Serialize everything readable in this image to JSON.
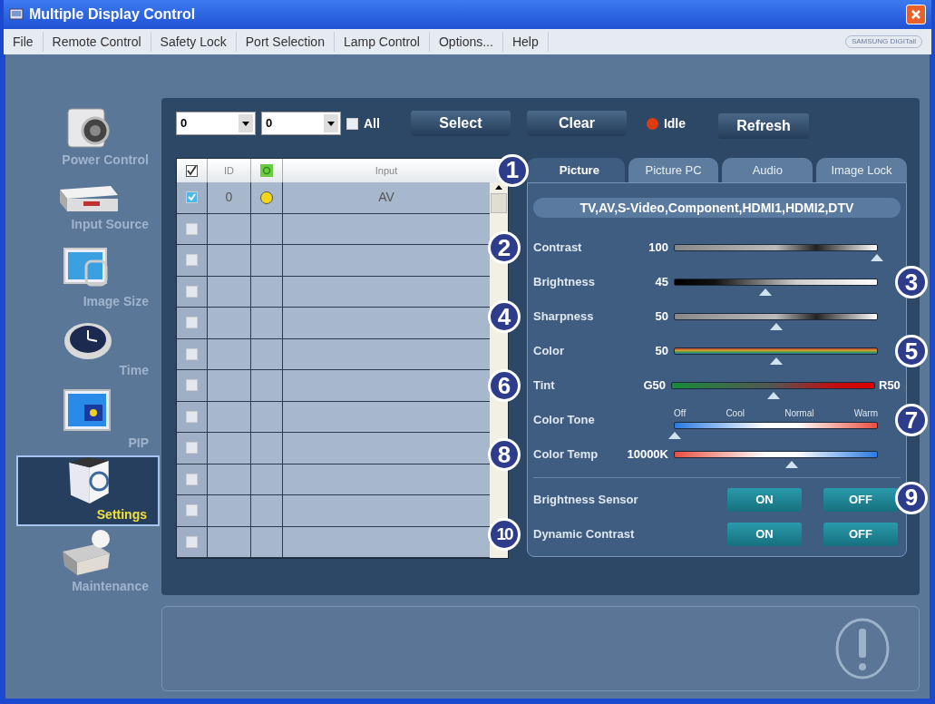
{
  "window": {
    "title": "Multiple Display Control"
  },
  "menu": [
    "File",
    "Remote Control",
    "Safety Lock",
    "Port Selection",
    "Lamp Control",
    "Options...",
    "Help"
  ],
  "logo": "SAMSUNG DIGITall",
  "sidebar": [
    {
      "label": "Power Control",
      "selected": false
    },
    {
      "label": "Input Source",
      "selected": false
    },
    {
      "label": "Image Size",
      "selected": false
    },
    {
      "label": "Time",
      "selected": false
    },
    {
      "label": "PIP",
      "selected": false
    },
    {
      "label": "Settings",
      "selected": true
    },
    {
      "label": "Maintenance",
      "selected": false
    }
  ],
  "toolbar": {
    "dropdowns": [
      "0",
      "0"
    ],
    "all": {
      "label": "All",
      "checked": false
    },
    "select": "Select",
    "clear": "Clear",
    "status": {
      "label": "Idle",
      "color": "#e03a10"
    },
    "refresh": "Refresh"
  },
  "table": {
    "header_checked": true,
    "columns": [
      "ID",
      "Input"
    ],
    "rows": [
      {
        "checked": true,
        "id": "0",
        "color": "#f0d818",
        "input": "AV"
      },
      {
        "checked": false
      },
      {
        "checked": false
      },
      {
        "checked": false
      },
      {
        "checked": false
      },
      {
        "checked": false
      },
      {
        "checked": false
      },
      {
        "checked": false
      },
      {
        "checked": false
      },
      {
        "checked": false
      },
      {
        "checked": false
      },
      {
        "checked": false
      }
    ]
  },
  "tabs": [
    {
      "label": "Picture",
      "selected": true
    },
    {
      "label": "Picture PC",
      "selected": false
    },
    {
      "label": "Audio",
      "selected": false
    },
    {
      "label": "Image Lock",
      "selected": false
    }
  ],
  "tab_callout": "1",
  "sources": "TV,AV,S-Video,Component,HDMI1,HDMI2,DTV",
  "settings": [
    {
      "kind": "slider",
      "label": "Contrast",
      "value": "100",
      "level": 1.0,
      "callout": "2"
    },
    {
      "kind": "slider",
      "label": "Brightness",
      "value": "45",
      "level": 0.45,
      "callout": "3"
    },
    {
      "kind": "slider",
      "label": "Sharpness",
      "value": "50",
      "level": 0.5,
      "callout": "4"
    },
    {
      "kind": "slider",
      "label": "Color",
      "value": "50",
      "level": 0.5,
      "callout": "5"
    },
    {
      "kind": "tint",
      "label": "Tint",
      "left_label": "G50",
      "right_label": "R50",
      "level": 0.5,
      "callout": "6"
    },
    {
      "kind": "scale",
      "label": "Color Tone",
      "scale_labels": [
        "Off",
        "Cool",
        "Normal",
        "Warm"
      ],
      "level": 0.0,
      "callout": "7"
    },
    {
      "kind": "slider",
      "label": "Color Temp",
      "value": "10000K",
      "level": 0.58,
      "callout": "8"
    },
    {
      "kind": "toggle",
      "label": "Brightness Sensor",
      "buttons": [
        "ON",
        "OFF"
      ],
      "callout": "9"
    },
    {
      "kind": "toggle",
      "label": "Dynamic Contrast",
      "buttons": [
        "ON",
        "OFF"
      ],
      "callout": "10"
    }
  ]
}
